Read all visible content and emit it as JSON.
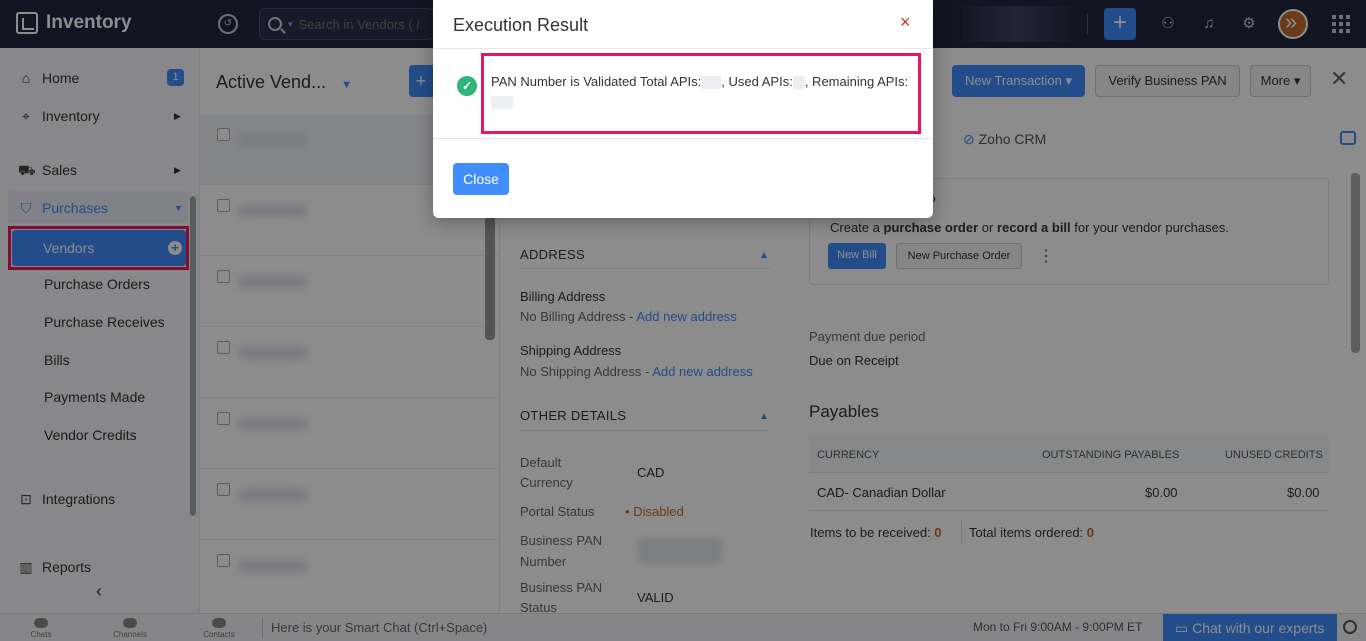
{
  "app": {
    "title": "Inventory"
  },
  "search": {
    "placeholder": "Search in Vendors ( / )"
  },
  "sidebar": {
    "home": "Home",
    "home_badge": "1",
    "inventory": "Inventory",
    "sales": "Sales",
    "purchases": "Purchases",
    "vendors": "Vendors",
    "purchase_orders": "Purchase Orders",
    "purchase_receives": "Purchase Receives",
    "bills": "Bills",
    "payments_made": "Payments Made",
    "vendor_credits": "Vendor Credits",
    "integrations": "Integrations",
    "reports": "Reports"
  },
  "list": {
    "title": "Active Vend..."
  },
  "toolbar": {
    "new_transaction": "New Transaction",
    "verify_pan": "Verify Business PAN",
    "more": "More"
  },
  "tabs": {
    "zoho_crm": "Zoho CRM"
  },
  "address": {
    "heading": "ADDRESS",
    "billing_label": "Billing Address",
    "billing_value": "No Billing Address -",
    "billing_link": "Add new address",
    "shipping_label": "Shipping Address",
    "shipping_value": "No Shipping Address -",
    "shipping_link": "Add new address"
  },
  "other": {
    "heading": "OTHER DETAILS",
    "currency_label_1": "Default",
    "currency_label_2": "Currency",
    "currency_value": "CAD",
    "portal_label": "Portal Status",
    "portal_value": "Disabled",
    "pan_label_1": "Business PAN",
    "pan_label_2": "Number",
    "pan_status_label_1": "Business PAN",
    "pan_status_label_2": "Status",
    "pan_status_value": "VALID"
  },
  "info": {
    "question_mark": "?",
    "text_1": "Create a",
    "bold_1": "purchase order",
    "text_2": "or",
    "bold_2": "record a bill",
    "text_3": "for your vendor purchases.",
    "new_bill": "New Bill",
    "new_po": "New Purchase Order",
    "kebab": "⋮"
  },
  "payment": {
    "label": "Payment due period",
    "value": "Due on Receipt"
  },
  "payables": {
    "title": "Payables",
    "columns": [
      "CURRENCY",
      "OUTSTANDING PAYABLES",
      "UNUSED CREDITS"
    ],
    "rows": [
      {
        "currency": "CAD- Canadian Dollar",
        "outstanding": "$0.00",
        "unused": "$0.00"
      }
    ]
  },
  "items": {
    "received_label": "Items to be received:",
    "received_value": "0",
    "total_label": "Total items ordered:",
    "total_value": "0"
  },
  "bottom": {
    "chats": "Chats",
    "channels": "Channels",
    "contacts": "Contacts",
    "smart_chat": "Here is your Smart Chat (Ctrl+Space)",
    "hours": "Mon to Fri 9:00AM - 9:00PM ET",
    "chat_experts": "Chat with our experts"
  },
  "modal": {
    "title": "Execution Result",
    "close_x": "×",
    "message_1": "PAN Number is Validated Total APIs:",
    "message_2": ", Used APIs:",
    "message_3": ", Remaining APIs:",
    "close_button": "Close"
  },
  "colors": {
    "accent": "#408dfb",
    "highlight": "#e8175d",
    "success": "#2eb67d",
    "topbar": "#21263c"
  }
}
